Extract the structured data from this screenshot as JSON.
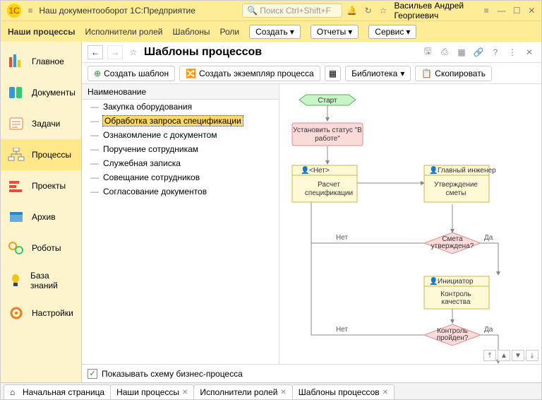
{
  "titlebar": {
    "title": "Наш документооборот 1С:Предприятие",
    "search_placeholder": "Поиск Ctrl+Shift+F",
    "user": "Васильев Андрей Георгиевич"
  },
  "toolbar": {
    "items": [
      "Наши процессы",
      "Исполнители ролей",
      "Шаблоны",
      "Роли"
    ],
    "create": "Создать",
    "reports": "Отчеты",
    "service": "Сервис"
  },
  "sidebar": [
    {
      "label": "Главное"
    },
    {
      "label": "Документы"
    },
    {
      "label": "Задачи"
    },
    {
      "label": "Процессы"
    },
    {
      "label": "Проекты"
    },
    {
      "label": "Архив"
    },
    {
      "label": "Роботы"
    },
    {
      "label": "База знаний"
    },
    {
      "label": "Настройки"
    }
  ],
  "content": {
    "heading": "Шаблоны процессов",
    "actions": {
      "create_template": "Создать шаблон",
      "create_instance": "Создать экземпляр процесса",
      "library": "Библиотека",
      "copy": "Скопировать"
    },
    "list_header": "Наименование",
    "templates": [
      "Закупка оборудования",
      "Обработка запроса спецификации",
      "Ознакомление с документом",
      "Поручение сотрудникам",
      "Служебная записка",
      "Совещание сотрудников",
      "Согласование документов"
    ],
    "checkbox_label": "Показывать схему бизнес-процесса"
  },
  "diagram": {
    "start": "Старт",
    "set_status": "Установить статус \"В работе\"",
    "none_role": "<Нет>",
    "calc": "Расчет спецификации",
    "engineer_role": "Главный инженер",
    "approve": "Утверждение сметы",
    "decision1": "Смета утверждена?",
    "initiator_role": "Инициатор",
    "quality": "Контроль качества",
    "decision2": "Контроль пройден?",
    "yes": "Да",
    "no": "Нет"
  },
  "tabs": [
    "Начальная страница",
    "Наши процессы",
    "Исполнители ролей",
    "Шаблоны процессов"
  ]
}
